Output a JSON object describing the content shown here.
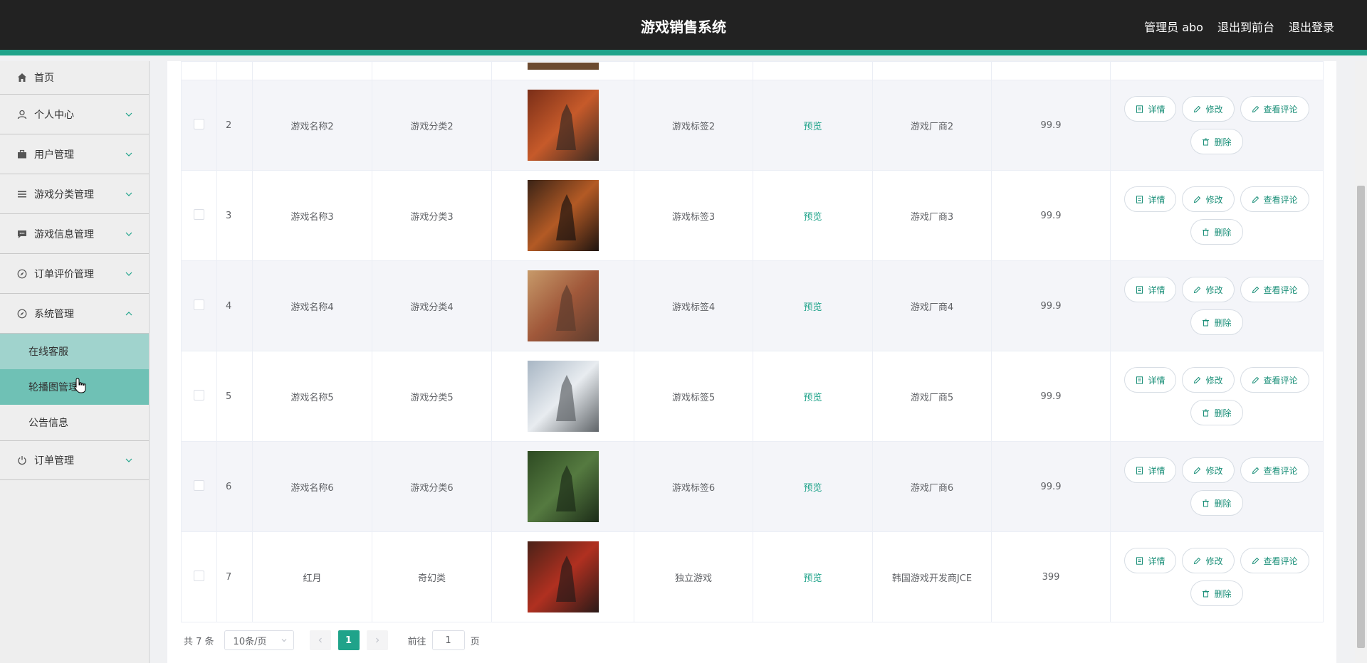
{
  "header": {
    "title": "游戏销售系统",
    "admin_label": "管理员 abo",
    "to_front": "退出到前台",
    "logout": "退出登录",
    "accent_color": "#1fa38a"
  },
  "sidebar": {
    "items": [
      {
        "label": "首页",
        "icon": "home-icon"
      },
      {
        "label": "个人中心",
        "icon": "user-icon"
      },
      {
        "label": "用户管理",
        "icon": "briefcase-icon"
      },
      {
        "label": "游戏分类管理",
        "icon": "list-icon"
      },
      {
        "label": "游戏信息管理",
        "icon": "message-icon"
      },
      {
        "label": "订单评价管理",
        "icon": "compass-icon"
      },
      {
        "label": "系统管理",
        "icon": "compass-icon"
      },
      {
        "label": "订单管理",
        "icon": "power-icon"
      }
    ],
    "sub_items": [
      "在线客服",
      "轮播图管理",
      "公告信息"
    ]
  },
  "table": {
    "preview_label": "预览",
    "buttons": {
      "detail": "详情",
      "edit": "修改",
      "comments": "查看评论",
      "delete": "删除"
    },
    "rows": [
      {
        "index": "2",
        "name": "游戏名称2",
        "category": "游戏分类2",
        "tag": "游戏标签2",
        "vendor": "游戏厂商2",
        "price": "99.9"
      },
      {
        "index": "3",
        "name": "游戏名称3",
        "category": "游戏分类3",
        "tag": "游戏标签3",
        "vendor": "游戏厂商3",
        "price": "99.9"
      },
      {
        "index": "4",
        "name": "游戏名称4",
        "category": "游戏分类4",
        "tag": "游戏标签4",
        "vendor": "游戏厂商4",
        "price": "99.9"
      },
      {
        "index": "5",
        "name": "游戏名称5",
        "category": "游戏分类5",
        "tag": "游戏标签5",
        "vendor": "游戏厂商5",
        "price": "99.9"
      },
      {
        "index": "6",
        "name": "游戏名称6",
        "category": "游戏分类6",
        "tag": "游戏标签6",
        "vendor": "游戏厂商6",
        "price": "99.9"
      },
      {
        "index": "7",
        "name": "红月",
        "category": "奇幻类",
        "tag": "独立游戏",
        "vendor": "韩国游戏开发商JCE",
        "price": "399"
      }
    ]
  },
  "pagination": {
    "total_text": "共 7 条",
    "page_size": "10条/页",
    "current_page": "1",
    "goto_label": "前往",
    "goto_value": "1",
    "page_suffix": "页"
  }
}
